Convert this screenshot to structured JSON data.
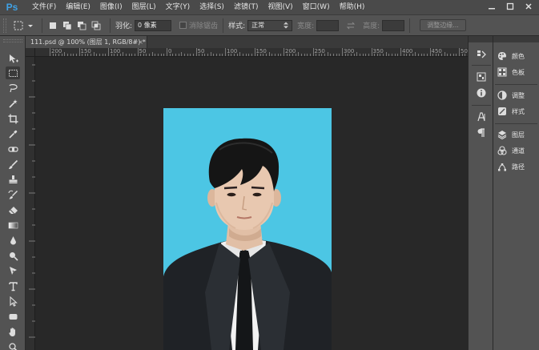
{
  "app": {
    "logo": "Ps"
  },
  "menu": [
    "文件(F)",
    "编辑(E)",
    "图像(I)",
    "图层(L)",
    "文字(Y)",
    "选择(S)",
    "滤镜(T)",
    "视图(V)",
    "窗口(W)",
    "帮助(H)"
  ],
  "options": {
    "feather_label": "羽化:",
    "feather_value": "0 像素",
    "antialias_label": "消除锯齿",
    "style_label": "样式:",
    "style_value": "正常",
    "width_label": "宽度:",
    "height_label": "高度:",
    "refine_button": "调整边缘..."
  },
  "document": {
    "tab_title": "111.psd @ 100% (图层 1, RGB/8#) *",
    "close": "×"
  },
  "ruler": {
    "labels": [
      "200",
      "150",
      "100",
      "50",
      "0",
      "50",
      "100",
      "150",
      "200",
      "250",
      "300",
      "350",
      "400",
      "450",
      "500"
    ]
  },
  "panels": {
    "color": "颜色",
    "swatches": "色板",
    "adjustments": "调整",
    "styles": "样式",
    "layers": "图层",
    "channels": "通道",
    "paths": "路径"
  },
  "colors": {
    "photo_background": "#4cc6e4",
    "ps_blue": "#3fa2e6"
  }
}
